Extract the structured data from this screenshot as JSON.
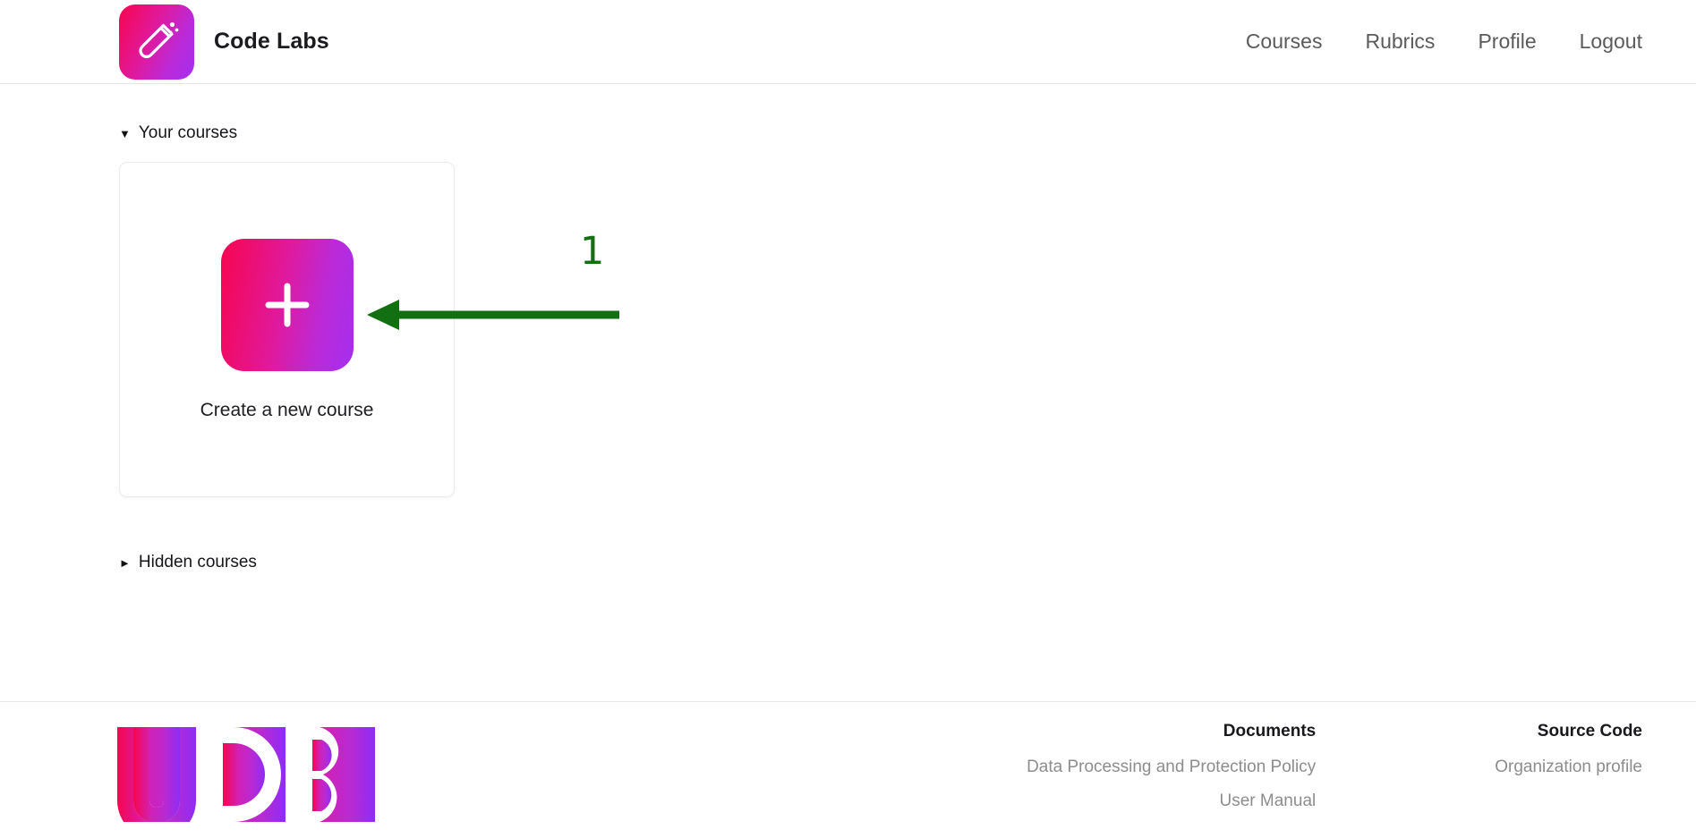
{
  "header": {
    "brand_name": "Code Labs",
    "logo_icon": "test-tube-icon",
    "nav": [
      {
        "label": "Courses"
      },
      {
        "label": "Rubrics"
      },
      {
        "label": "Profile"
      },
      {
        "label": "Logout"
      }
    ]
  },
  "main": {
    "your_courses": {
      "label": "Your courses",
      "caret": "▼",
      "expanded": true
    },
    "hidden_courses": {
      "label": "Hidden courses",
      "caret": "►",
      "expanded": false
    },
    "cards": [
      {
        "label": "Create a new course",
        "icon": "plus-icon"
      }
    ]
  },
  "annotation": {
    "step_number": "1",
    "color": "#127012",
    "arrow_direction": "left",
    "target": "create-a-new-course-tile"
  },
  "footer": {
    "logo_text": "UDB",
    "columns": [
      {
        "heading": "Documents",
        "links": [
          {
            "label": "Data Processing and Protection Policy"
          },
          {
            "label": "User Manual"
          }
        ]
      },
      {
        "heading": "Source Code",
        "links": [
          {
            "label": "Organization profile"
          }
        ]
      }
    ]
  },
  "colors": {
    "gradient_start": "#f7054e",
    "gradient_mid": "#d121b6",
    "gradient_end": "#a42ff0",
    "annotation_green": "#127012",
    "text_primary": "#1a1a1f",
    "text_muted": "#8d8d8d",
    "nav_text": "#5b5b5b",
    "border": "#e6e6e6"
  }
}
